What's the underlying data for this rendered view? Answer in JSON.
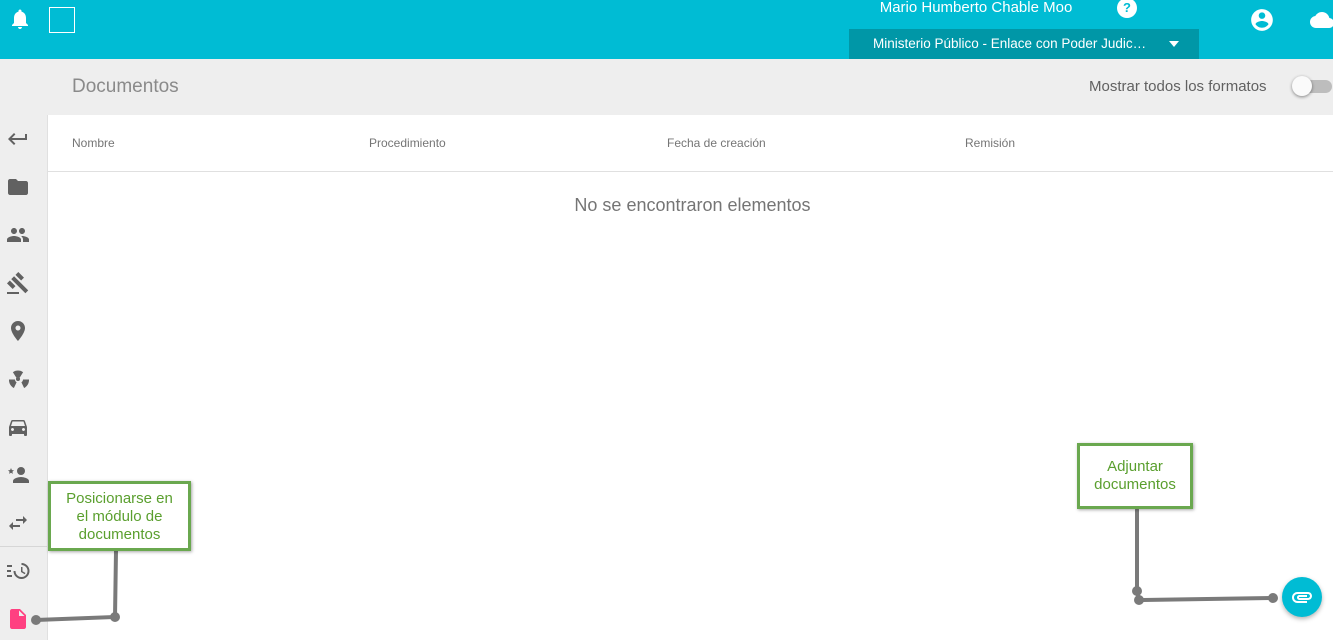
{
  "topbar": {
    "icons": [
      "bell-icon",
      "square-outline-icon",
      "help-icon",
      "account-circle-icon",
      "cloud-icon"
    ],
    "user_name": "Mario Humberto Chable Moo",
    "help_glyph": "?",
    "role_selected": "Ministerio Público - Enlace con Poder Judic…",
    "background_color": "#00bcd4",
    "selector_color": "#0097a7"
  },
  "header": {
    "title": "Documentos",
    "toggle_label": "Mostrar todos los formatos",
    "toggle_on": false
  },
  "sidebar": {
    "items": [
      {
        "icon": "arrow-back-icon"
      },
      {
        "icon": "folder-icon"
      },
      {
        "icon": "people-icon"
      },
      {
        "icon": "gavel-icon"
      },
      {
        "icon": "location-pin-icon"
      },
      {
        "icon": "radioactive-icon"
      },
      {
        "icon": "car-icon"
      },
      {
        "icon": "person-star-icon"
      },
      {
        "icon": "swap-arrows-icon"
      },
      {
        "icon": "history-icon"
      },
      {
        "icon": "document-icon",
        "active": true,
        "color": "#ff4081"
      }
    ]
  },
  "table": {
    "columns": [
      "Nombre",
      "Procedimiento",
      "Fecha de creación",
      "Remisión"
    ],
    "rows": [],
    "empty_message": "No se encontraron elementos"
  },
  "fab": {
    "icon": "attachment-icon",
    "color": "#00bcd4"
  },
  "annotations": [
    {
      "lines": [
        "Posicionarse en",
        "el módulo de",
        "documentos"
      ],
      "border_color": "#6aa84f",
      "text_color": "#5a9f2e"
    },
    {
      "lines": [
        "Adjuntar",
        "documentos"
      ],
      "border_color": "#6aa84f",
      "text_color": "#5a9f2e"
    }
  ]
}
